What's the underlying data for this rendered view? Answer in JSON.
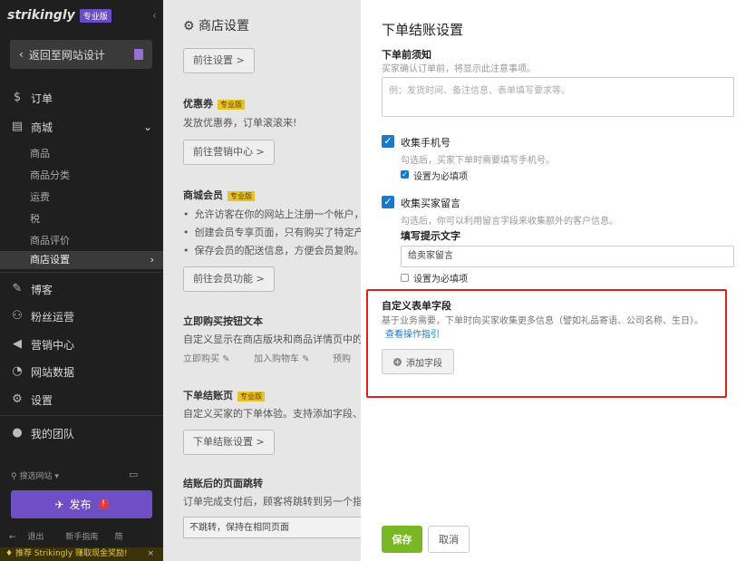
{
  "sidebar": {
    "logo": "strikingly",
    "pro_badge": "专业版",
    "back_label": "返回至网站设计",
    "nav": {
      "orders": "订单",
      "store": "商城",
      "blog": "博客",
      "fans": "粉丝运营",
      "marketing": "营销中心",
      "analytics": "网站数据",
      "settings": "设置",
      "team": "我的团队"
    },
    "store_sub": [
      "商品",
      "商品分类",
      "运费",
      "税",
      "商品评价",
      "商店设置"
    ],
    "site_search": "搜选网站",
    "publish": "发布",
    "bottom": [
      "退出",
      "新手指南",
      "简"
    ],
    "promo": "推荐 Strikingly 赚取现金奖励!"
  },
  "main": {
    "title": "商店设置",
    "goto_settings_btn": "前往设置 >",
    "coupon_title": "优惠券",
    "pro_badge": "专业版",
    "coupon_desc": "发放优惠券，订单滚滚来!",
    "coupon_btn": "前往营销中心 >",
    "member_title": "商城会员",
    "member_items": [
      "允许访客在你的网站上注册一个帐户，",
      "创建会员专享页面，只有购买了特定产",
      "保存会员的配送信息，方便会员复购。"
    ],
    "member_btn": "前往会员功能 >",
    "buynow_title": "立即购买按钮文本",
    "buynow_desc": "自定义显示在商店版块和商品详情页中的按",
    "buynow_links": [
      "立即购买",
      "加入购物车",
      "预购"
    ],
    "checkout_title": "下单结账页",
    "checkout_desc": "自定义买家的下单体验。支持添加字段、调",
    "checkout_btn": "下单结账设置 >",
    "redirect_title": "结账后的页面跳转",
    "redirect_desc": "订单完成支付后，顾客将跳转到另一个指定",
    "redirect_value": "不跳转，保持在相同页面"
  },
  "panel": {
    "title": "下单结账设置",
    "notice_label": "下单前须知",
    "notice_hint": "买家确认订单前，将显示此注意事项。",
    "notice_placeholder": "例：发货时间、备注信息、表单填写要求等。",
    "phone_label": "收集手机号",
    "phone_hint": "勾选后，买家下单时需要填写手机号。",
    "phone_required": "设置为必填项",
    "phone_checked": true,
    "phone_required_checked": true,
    "msg_label": "收集买家留言",
    "msg_hint": "勾选后，你可以利用留言字段来收集额外的客户信息。",
    "msg_checked": true,
    "prompt_label": "填写提示文字",
    "prompt_value": "给卖家留言",
    "msg_required": "设置为必填项",
    "msg_required_checked": false,
    "custom_label": "自定义表单字段",
    "custom_hint": "基于业务需要，下单时向买家收集更多信息（譬如礼品寄语、公司名称、生日）。",
    "custom_help": "查看操作指引",
    "add_field": "添加字段",
    "save": "保存",
    "cancel": "取消"
  },
  "colors": {
    "accent_blue": "#1e78c8",
    "save_green": "#78b824",
    "publish_purple": "#6f4fc6",
    "highlight_red": "#e02020"
  }
}
